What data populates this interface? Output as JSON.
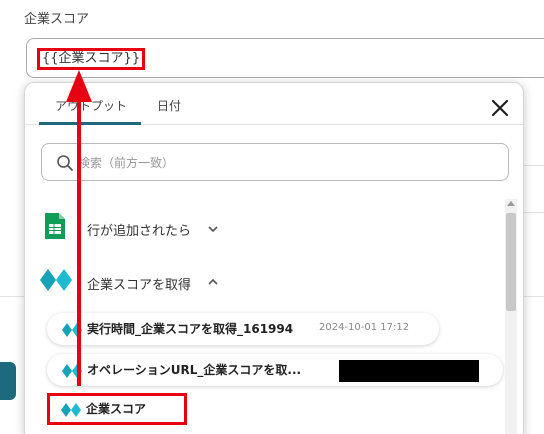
{
  "field": {
    "label": "企業スコア",
    "value": "{{企業スコア}}"
  },
  "popup": {
    "tabs": [
      {
        "label": "アウトプット"
      },
      {
        "label": "日付"
      }
    ],
    "search_placeholder": "検索（前方一致）",
    "sections": [
      {
        "label": "行が追加されたら",
        "icon": "google-sheets-icon",
        "expanded": false
      },
      {
        "label": "企業スコアを取得",
        "icon": "diamond-app-icon",
        "expanded": true
      }
    ],
    "items": [
      {
        "label": "実行時間_企業スコアを取得_161994",
        "date": "2024-10-01 17:12"
      },
      {
        "label": "オペレーションURL_企業スコアを取..."
      },
      {
        "label": "企業スコア"
      }
    ]
  },
  "colors": {
    "accent": "#1d6a7c",
    "highlight": "#e60012",
    "sheets_green": "#0f9d58",
    "diamond_teal": "#17a2b8"
  }
}
